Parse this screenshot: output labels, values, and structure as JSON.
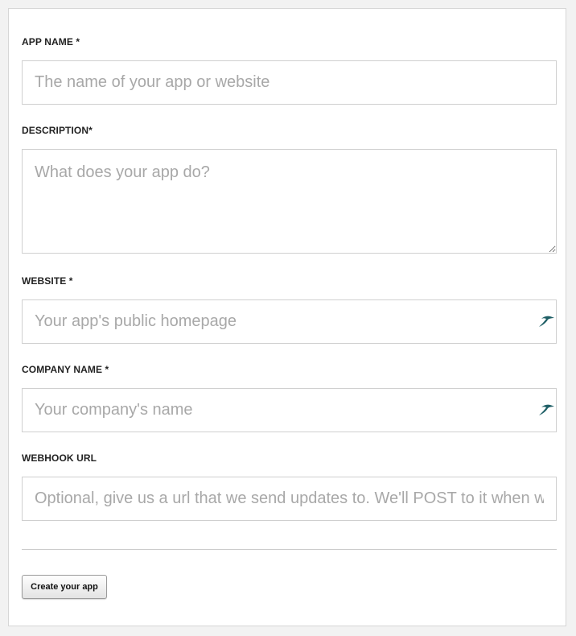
{
  "form": {
    "app_name": {
      "label": "APP NAME *",
      "placeholder": "The name of your app or website",
      "value": ""
    },
    "description": {
      "label": "DESCRIPTION*",
      "placeholder": "What does your app do?",
      "value": ""
    },
    "website": {
      "label": "WEBSITE *",
      "placeholder": "Your app's public homepage",
      "value": "",
      "icon": "autofill-bird-icon"
    },
    "company_name": {
      "label": "COMPANY NAME *",
      "placeholder": "Your company's name",
      "value": "",
      "icon": "autofill-bird-icon"
    },
    "webhook_url": {
      "label": "WEBHOOK URL",
      "placeholder": "Optional, give us a url that we send updates to. We'll POST to it when we have something to tell you.",
      "value": ""
    },
    "submit_label": "Create your app"
  },
  "colors": {
    "icon": "#1f5f66",
    "label": "#222222",
    "placeholder": "#a8a8a8"
  }
}
